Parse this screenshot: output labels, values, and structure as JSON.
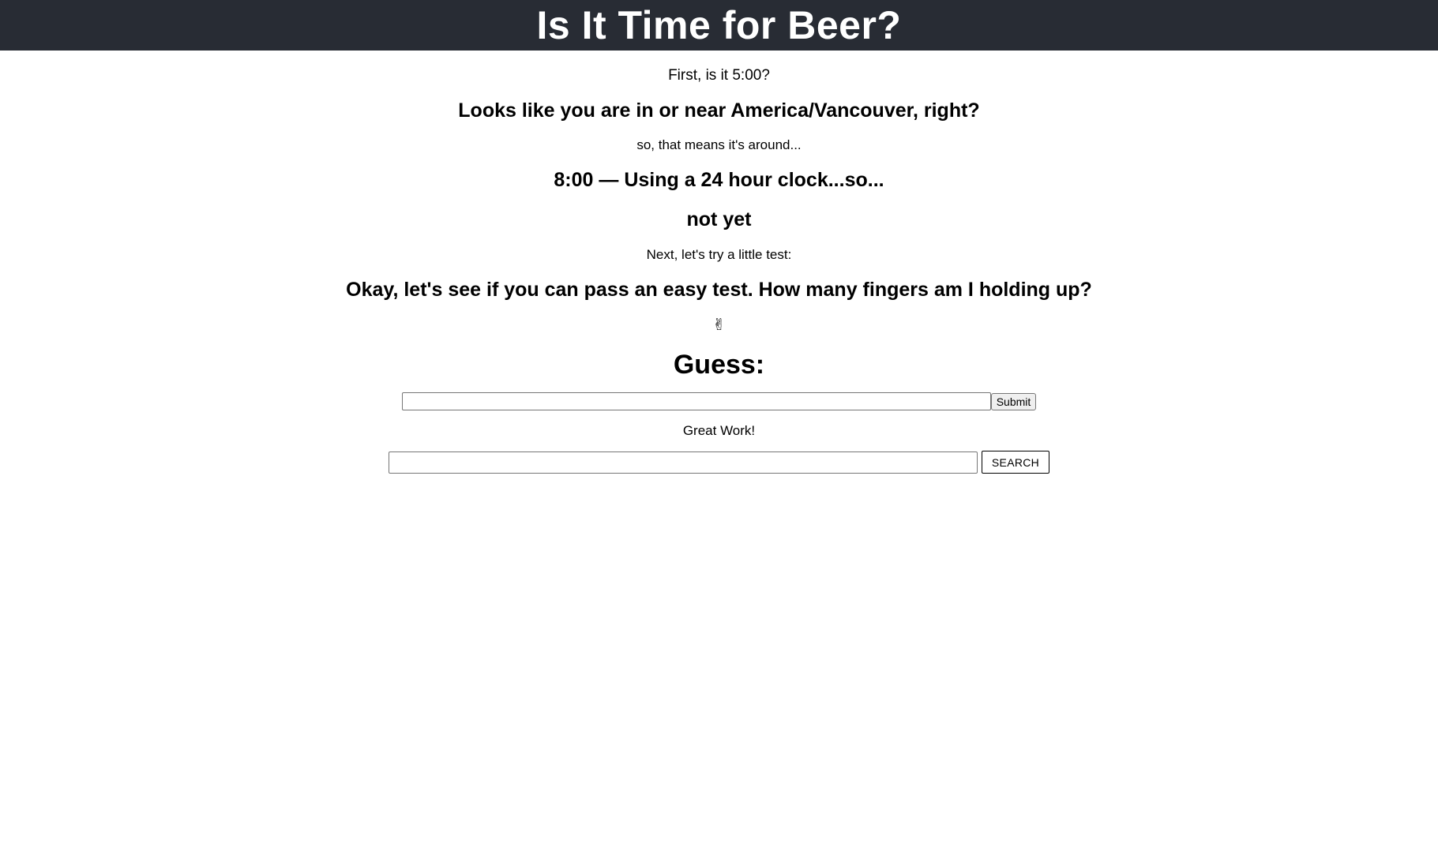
{
  "header": {
    "title": "Is It Time for Beer?"
  },
  "main": {
    "first_question": "First, is it 5:00?",
    "location_heading": "Looks like you are in or near America/Vancouver, right?",
    "means_text": "so, that means it's around...",
    "time_heading": "8:00 — Using a 24 hour clock...so...",
    "verdict": "not yet",
    "next_text": "Next, let's try a little test:",
    "test_heading": "Okay, let's see if you can pass an easy test. How many fingers am I holding up?",
    "hand_glyph": "✌",
    "hand_icon": "victory-hand-icon",
    "guess_heading": "Guess:",
    "guess_input": {
      "value": "",
      "placeholder": ""
    },
    "submit_label": "Submit",
    "feedback": "Great Work!",
    "search_input": {
      "value": "",
      "placeholder": ""
    },
    "search_label": "SEARCH"
  },
  "colors": {
    "header_bg": "#282c34",
    "header_text": "#ffffff"
  }
}
